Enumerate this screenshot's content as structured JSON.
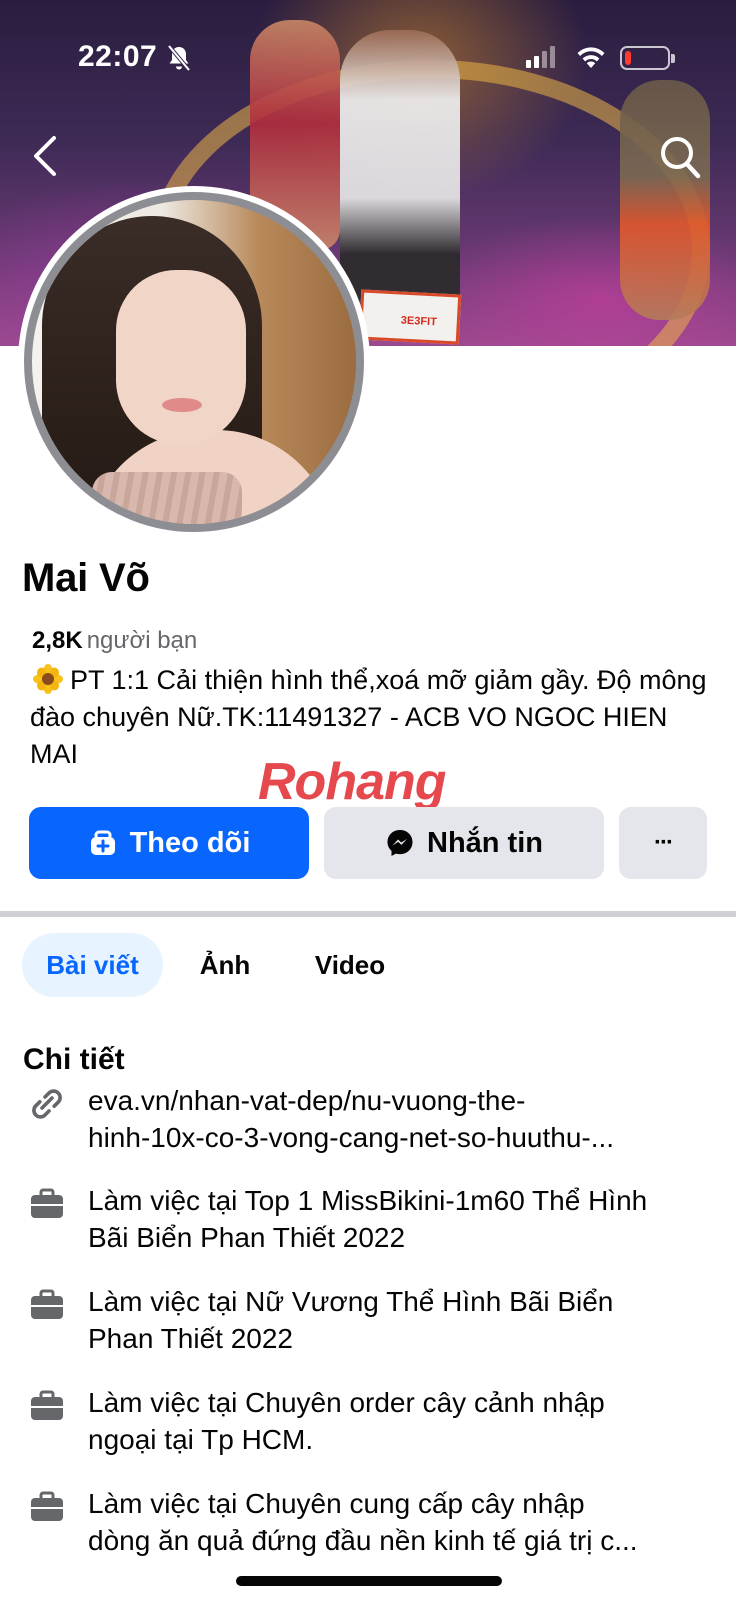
{
  "status_bar": {
    "time": "22:07",
    "battery_level": 0.15,
    "battery_color": "#ff3b30"
  },
  "cover": {
    "banner_text": "3E3FIT"
  },
  "header": {
    "back_icon": "chevron-left-icon",
    "search_icon": "search-icon"
  },
  "profile": {
    "name": "Mai Võ",
    "friends_count": "2,8K",
    "friends_label": "người bạn",
    "bio": "PT 1:1 Cải thiện hình thể,xoá mỡ giảm gầy. Độ mông đào chuyên Nữ.TK:11491327 - ACB VO NGOC HIEN MAI"
  },
  "watermark": {
    "part1": "Rohang",
    "part2": ""
  },
  "actions": {
    "follow_label": "Theo dõi",
    "message_label": "Nhắn tin",
    "more_label": "···",
    "primary_color": "#0866ff"
  },
  "tabs": [
    {
      "label": "Bài viết",
      "active": true
    },
    {
      "label": "Ảnh",
      "active": false
    },
    {
      "label": "Video",
      "active": false
    }
  ],
  "details": {
    "title": "Chi tiết",
    "items": [
      {
        "icon": "link-icon",
        "line1": "eva.vn/nhan-vat-dep/nu-vuong-the-",
        "line2": "hinh-10x-co-3-vong-cang-net-so-huuthu-..."
      },
      {
        "icon": "briefcase-icon",
        "line1": "Làm việc tại Top 1 MissBikini-1m60 Thể Hình",
        "line2": "Bãi Biển Phan Thiết 2022"
      },
      {
        "icon": "briefcase-icon",
        "line1": "Làm việc tại Nữ Vương Thể Hình Bãi Biển",
        "line2": "Phan Thiết 2022"
      },
      {
        "icon": "briefcase-icon",
        "line1": "Làm việc tại Chuyên order cây cảnh nhập",
        "line2": "ngoại tại Tp HCM."
      },
      {
        "icon": "briefcase-icon",
        "line1": "Làm việc tại Chuyên cung cấp cây nhập",
        "line2": "dòng ăn quả đứng đầu nền kinh tế giá trị c..."
      }
    ]
  }
}
